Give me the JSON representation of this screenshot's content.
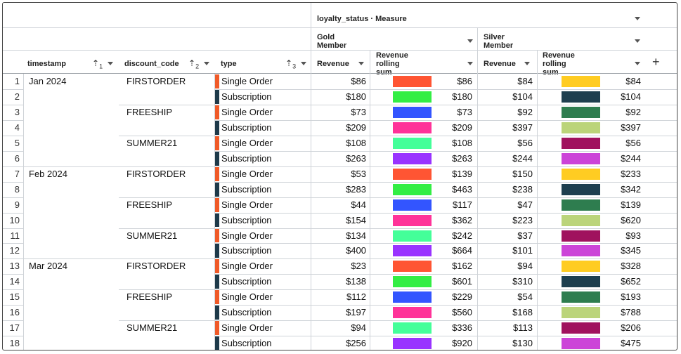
{
  "header": {
    "pivot_title": "loyalty_status · Measure",
    "groups": [
      "Gold Member",
      "Silver Member"
    ],
    "columns": {
      "timestamp": "timestamp",
      "discount_code": "discount_code",
      "type": "type",
      "gold_revenue": "Revenue",
      "gold_rolling": "Revenue rolling sum",
      "silver_revenue": "Revenue",
      "silver_rolling": "Revenue rolling sum"
    },
    "sort_badges": [
      "1",
      "2",
      "3"
    ],
    "add_label": "+"
  },
  "colors": {
    "single_order": "#f05a28",
    "subscription": "#1e3a4a",
    "gold_swatches": [
      "#ff5533",
      "#33ee44",
      "#3355ff",
      "#ff3399",
      "#44ff99",
      "#9933ff"
    ],
    "silver_swatches": [
      "#ffcc22",
      "#1e3f4f",
      "#2e7d4f",
      "#bbd47a",
      "#a0125e",
      "#cc44d8"
    ]
  },
  "rows": [
    {
      "n": "1",
      "ts": "Jan 2024",
      "dc": "FIRSTORDER",
      "type": "Single Order",
      "gr": "$86",
      "grs": "$86",
      "sr": "$84",
      "srs": "$84"
    },
    {
      "n": "2",
      "ts": "",
      "dc": "",
      "type": "Subscription",
      "gr": "$180",
      "grs": "$180",
      "sr": "$104",
      "srs": "$104"
    },
    {
      "n": "3",
      "ts": "",
      "dc": "FREESHIP",
      "type": "Single Order",
      "gr": "$73",
      "grs": "$73",
      "sr": "$92",
      "srs": "$92"
    },
    {
      "n": "4",
      "ts": "",
      "dc": "",
      "type": "Subscription",
      "gr": "$209",
      "grs": "$209",
      "sr": "$397",
      "srs": "$397"
    },
    {
      "n": "5",
      "ts": "",
      "dc": "SUMMER21",
      "type": "Single Order",
      "gr": "$108",
      "grs": "$108",
      "sr": "$56",
      "srs": "$56"
    },
    {
      "n": "6",
      "ts": "",
      "dc": "",
      "type": "Subscription",
      "gr": "$263",
      "grs": "$263",
      "sr": "$244",
      "srs": "$244"
    },
    {
      "n": "7",
      "ts": "Feb 2024",
      "dc": "FIRSTORDER",
      "type": "Single Order",
      "gr": "$53",
      "grs": "$139",
      "sr": "$150",
      "srs": "$233"
    },
    {
      "n": "8",
      "ts": "",
      "dc": "",
      "type": "Subscription",
      "gr": "$283",
      "grs": "$463",
      "sr": "$238",
      "srs": "$342"
    },
    {
      "n": "9",
      "ts": "",
      "dc": "FREESHIP",
      "type": "Single Order",
      "gr": "$44",
      "grs": "$117",
      "sr": "$47",
      "srs": "$139"
    },
    {
      "n": "10",
      "ts": "",
      "dc": "",
      "type": "Subscription",
      "gr": "$154",
      "grs": "$362",
      "sr": "$223",
      "srs": "$620"
    },
    {
      "n": "11",
      "ts": "",
      "dc": "SUMMER21",
      "type": "Single Order",
      "gr": "$134",
      "grs": "$242",
      "sr": "$37",
      "srs": "$93"
    },
    {
      "n": "12",
      "ts": "",
      "dc": "",
      "type": "Subscription",
      "gr": "$400",
      "grs": "$664",
      "sr": "$101",
      "srs": "$345"
    },
    {
      "n": "13",
      "ts": "Mar 2024",
      "dc": "FIRSTORDER",
      "type": "Single Order",
      "gr": "$23",
      "grs": "$162",
      "sr": "$94",
      "srs": "$328"
    },
    {
      "n": "14",
      "ts": "",
      "dc": "",
      "type": "Subscription",
      "gr": "$138",
      "grs": "$601",
      "sr": "$310",
      "srs": "$652"
    },
    {
      "n": "15",
      "ts": "",
      "dc": "FREESHIP",
      "type": "Single Order",
      "gr": "$112",
      "grs": "$229",
      "sr": "$54",
      "srs": "$193"
    },
    {
      "n": "16",
      "ts": "",
      "dc": "",
      "type": "Subscription",
      "gr": "$197",
      "grs": "$560",
      "sr": "$168",
      "srs": "$788"
    },
    {
      "n": "17",
      "ts": "",
      "dc": "SUMMER21",
      "type": "Single Order",
      "gr": "$94",
      "grs": "$336",
      "sr": "$113",
      "srs": "$206"
    },
    {
      "n": "18",
      "ts": "",
      "dc": "",
      "type": "Subscription",
      "gr": "$256",
      "grs": "$920",
      "sr": "$130",
      "srs": "$475"
    }
  ]
}
